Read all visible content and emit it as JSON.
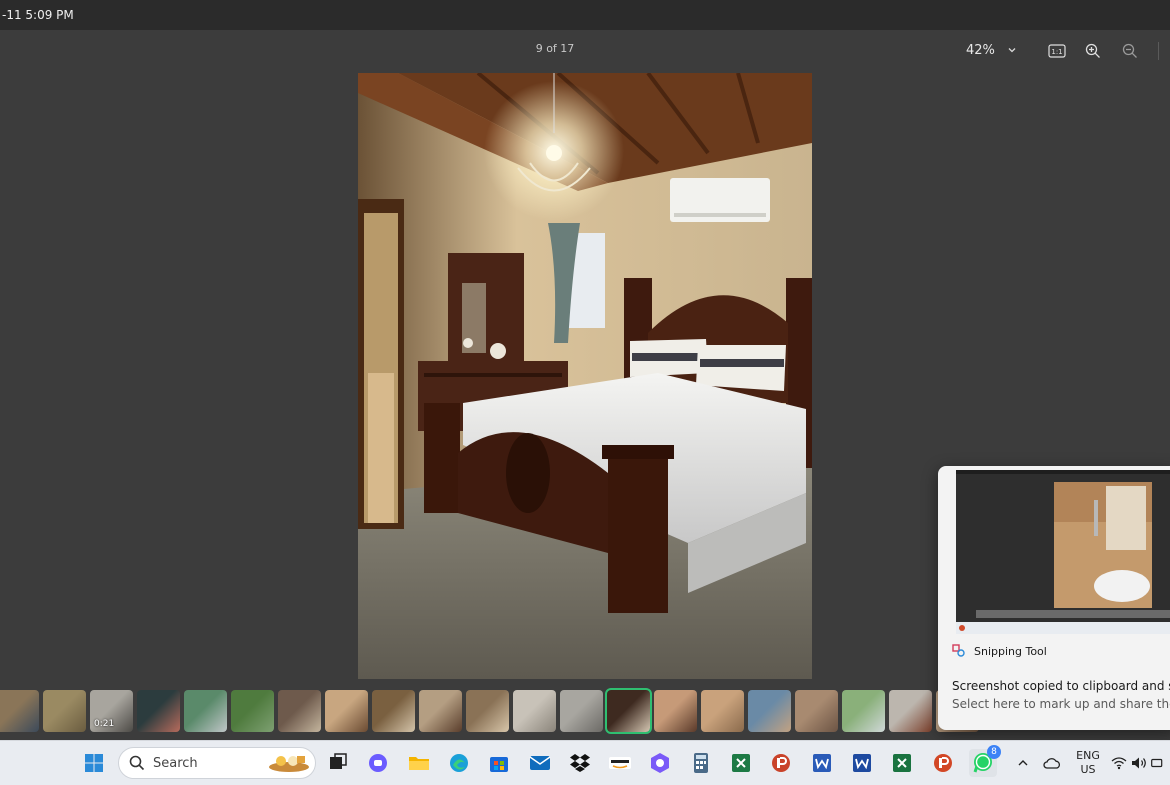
{
  "title_bar": {
    "time_text": "-11 5:09 PM"
  },
  "viewer": {
    "counter": "9 of 17",
    "zoom_value": "42%",
    "tools": [
      {
        "name": "actual-size-button",
        "icon": "actual-size-icon",
        "label": "1:1"
      },
      {
        "name": "zoom-in-button",
        "icon": "zoom-in-icon"
      },
      {
        "name": "zoom-out-button",
        "icon": "zoom-out-icon"
      }
    ],
    "image": {
      "subject": "bedroom-photo"
    }
  },
  "filmstrip": {
    "thumbnails": [
      {
        "tone": "#8a7558",
        "tone2": "#3c4a5a"
      },
      {
        "tone": "#9a8a62",
        "tone2": "#6a5c40"
      },
      {
        "tone": "#a8a59e",
        "tone2": "#4c4a46",
        "duration": "0:21"
      },
      {
        "tone": "#2c3c3e",
        "tone2": "#b76b5c"
      },
      {
        "tone": "#5a8a6a",
        "tone2": "#c0c6c8"
      },
      {
        "tone": "#4f7b3e",
        "tone2": "#7ea072"
      },
      {
        "tone": "#6e5a4c",
        "tone2": "#c4b59e"
      },
      {
        "tone": "#c8a680",
        "tone2": "#6a4a32"
      },
      {
        "tone": "#7a6040",
        "tone2": "#d4c4aa"
      },
      {
        "tone": "#b49e82",
        "tone2": "#5a3e2c"
      },
      {
        "tone": "#8a7256",
        "tone2": "#d8c6aa"
      },
      {
        "tone": "#c8c2b8",
        "tone2": "#8a847a"
      },
      {
        "tone": "#a8a6a0",
        "tone2": "#6c6a66"
      },
      {
        "tone": "#3e2a20",
        "tone2": "#d4c6b2",
        "selected": true
      },
      {
        "tone": "#c69a78",
        "tone2": "#5a3a2a"
      },
      {
        "tone": "#c9a27c",
        "tone2": "#8a6a4c"
      },
      {
        "tone": "#6a8aa6",
        "tone2": "#c2a282"
      },
      {
        "tone": "#a88a70",
        "tone2": "#6c5444"
      },
      {
        "tone": "#8ab07a",
        "tone2": "#d0d8d8"
      },
      {
        "tone": "#bcb6ae",
        "tone2": "#7a3e2a"
      },
      {
        "tone": "#c2a688",
        "tone2": "#7a5c44"
      }
    ]
  },
  "toast": {
    "app_name": "Snipping Tool",
    "line1": "Screenshot copied to clipboard and sav",
    "line2": "Select here to mark up and share the in"
  },
  "taskbar": {
    "search_label": "Search",
    "whatsapp_badge": "8",
    "language": {
      "line1": "ENG",
      "line2": "US"
    },
    "apps": [
      {
        "name": "task-view",
        "icon": "task-view-icon",
        "color": "#222222"
      },
      {
        "name": "chat-app",
        "icon": "chat-icon",
        "color": "#6b5cff"
      },
      {
        "name": "file-explorer",
        "icon": "folder-icon",
        "color": "#f4b400"
      },
      {
        "name": "edge-browser",
        "icon": "edge-icon",
        "color": "#1aa0d8"
      },
      {
        "name": "store-app",
        "icon": "store-icon",
        "color": "#1769d8"
      },
      {
        "name": "mail-app",
        "icon": "mail-icon",
        "color": "#0f6cbd"
      },
      {
        "name": "dropbox-app",
        "icon": "dropbox-icon",
        "color": "#111111"
      },
      {
        "name": "amazon-app",
        "icon": "amazon-icon",
        "color": "#222222"
      },
      {
        "name": "copilot-app",
        "icon": "copilot-icon",
        "color": "#7a5af8"
      },
      {
        "name": "calculator-app",
        "icon": "calculator-icon",
        "color": "#4a6a88"
      },
      {
        "name": "excel-app",
        "icon": "excel-icon",
        "color": "#1d7a45"
      },
      {
        "name": "powerpoint-app",
        "icon": "powerpoint-icon",
        "color": "#c9432a"
      },
      {
        "name": "word-app",
        "icon": "word-icon",
        "color": "#2a5bb8"
      },
      {
        "name": "word-app-2",
        "icon": "word-icon",
        "color": "#1e4aa0"
      },
      {
        "name": "excel-app-2",
        "icon": "excel-icon",
        "color": "#1a7340"
      },
      {
        "name": "powerpoint-app-2",
        "icon": "powerpoint-icon",
        "color": "#d24726"
      },
      {
        "name": "whatsapp-app",
        "icon": "whatsapp-icon",
        "color": "#25d366"
      }
    ]
  }
}
